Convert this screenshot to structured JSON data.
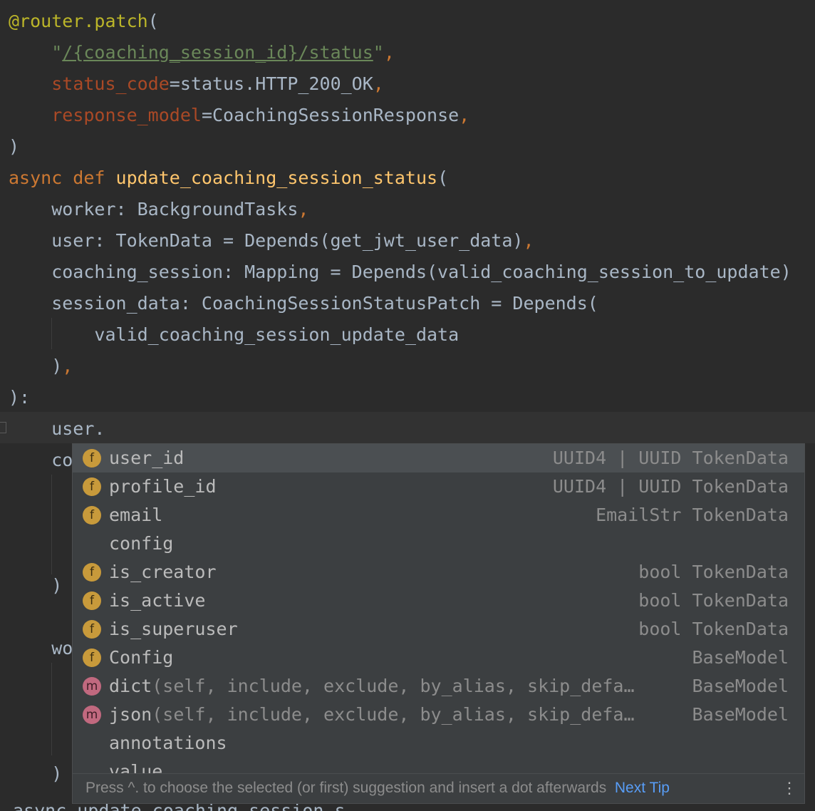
{
  "editor": {
    "lines": [
      [
        {
          "t": "@router.patch",
          "c": "deco"
        },
        {
          "t": "(",
          "c": "plain"
        }
      ],
      [
        {
          "t": "    ",
          "c": "plain"
        },
        {
          "t": "\"",
          "c": "str"
        },
        {
          "t": "/{coaching_session_id}/status",
          "c": "str-u"
        },
        {
          "t": "\"",
          "c": "str"
        },
        {
          "t": ",",
          "c": "kw"
        }
      ],
      [
        {
          "t": "    ",
          "c": "plain"
        },
        {
          "t": "status_code",
          "c": "param"
        },
        {
          "t": "=status.HTTP_200_OK",
          "c": "plain"
        },
        {
          "t": ",",
          "c": "kw"
        }
      ],
      [
        {
          "t": "    ",
          "c": "plain"
        },
        {
          "t": "response_model",
          "c": "param"
        },
        {
          "t": "=CoachingSessionResponse",
          "c": "plain"
        },
        {
          "t": ",",
          "c": "kw"
        }
      ],
      [
        {
          "t": ")",
          "c": "plain"
        }
      ],
      [
        {
          "t": "async def ",
          "c": "kw"
        },
        {
          "t": "update_coaching_session_status",
          "c": "fn"
        },
        {
          "t": "(",
          "c": "plain"
        }
      ],
      [
        {
          "t": "    worker: BackgroundTasks",
          "c": "plain"
        },
        {
          "t": ",",
          "c": "kw"
        }
      ],
      [
        {
          "t": "    user: TokenData = Depends(get_jwt_user_data)",
          "c": "plain"
        },
        {
          "t": ",",
          "c": "kw"
        }
      ],
      [
        {
          "t": "    coaching_session: Mapping = Depends(valid_coaching_session_to_update)",
          "c": "plain"
        }
      ],
      [
        {
          "t": "    session_data: CoachingSessionStatusPatch = Depends(",
          "c": "plain"
        }
      ],
      [
        {
          "t": "        valid_coaching_session_update_data",
          "c": "plain"
        }
      ],
      [
        {
          "t": "    )",
          "c": "plain"
        },
        {
          "t": ",",
          "c": "kw"
        }
      ],
      [
        {
          "t": "):",
          "c": "plain"
        }
      ],
      [
        {
          "t": "    user.",
          "c": "plain"
        }
      ],
      [
        {
          "t": "    co",
          "c": "plain"
        }
      ],
      [
        {
          "t": "",
          "c": "plain"
        }
      ],
      [
        {
          "t": "",
          "c": "plain"
        }
      ],
      [
        {
          "t": "",
          "c": "plain"
        }
      ],
      [
        {
          "t": "    )",
          "c": "plain"
        }
      ],
      [
        {
          "t": "",
          "c": "plain"
        }
      ],
      [
        {
          "t": "    wo",
          "c": "plain"
        }
      ],
      [
        {
          "t": "",
          "c": "plain"
        }
      ],
      [
        {
          "t": "",
          "c": "plain"
        }
      ],
      [
        {
          "t": "",
          "c": "plain"
        }
      ],
      [
        {
          "t": "    )",
          "c": "plain"
        }
      ]
    ],
    "bottom_partial": "async update_coaching_session_s"
  },
  "completion": {
    "items": [
      {
        "icon": "f",
        "icon_label": "f",
        "name": "user_id",
        "sig": "",
        "type": "UUID4 | UUID TokenData",
        "selected": true
      },
      {
        "icon": "f",
        "icon_label": "f",
        "name": "profile_id",
        "sig": "",
        "type": "UUID4 | UUID TokenData",
        "selected": false
      },
      {
        "icon": "f",
        "icon_label": "f",
        "name": "email",
        "sig": "",
        "type": "EmailStr TokenData",
        "selected": false
      },
      {
        "icon": "",
        "icon_label": "",
        "name": "config",
        "sig": "",
        "type": "",
        "selected": false
      },
      {
        "icon": "f",
        "icon_label": "f",
        "name": "is_creator",
        "sig": "",
        "type": "bool TokenData",
        "selected": false
      },
      {
        "icon": "f",
        "icon_label": "f",
        "name": "is_active",
        "sig": "",
        "type": "bool TokenData",
        "selected": false
      },
      {
        "icon": "f",
        "icon_label": "f",
        "name": "is_superuser",
        "sig": "",
        "type": "bool TokenData",
        "selected": false
      },
      {
        "icon": "f",
        "icon_label": "f",
        "name": "Config",
        "sig": "",
        "type": "BaseModel",
        "selected": false
      },
      {
        "icon": "m",
        "icon_label": "m",
        "name": "dict",
        "sig": "(self, include, exclude, by_alias, skip_defa…",
        "type": "BaseModel",
        "selected": false
      },
      {
        "icon": "m",
        "icon_label": "m",
        "name": "json",
        "sig": "(self, include, exclude, by_alias, skip_defa…",
        "type": "BaseModel",
        "selected": false
      },
      {
        "icon": "",
        "icon_label": "",
        "name": "annotations",
        "sig": "",
        "type": "",
        "selected": false
      },
      {
        "icon": "",
        "icon_label": "",
        "name": "value",
        "sig": "",
        "type": "",
        "selected": false
      }
    ],
    "footer": {
      "hint": "Press ^. to choose the selected (or first) suggestion and insert a dot afterwards",
      "tip_link": "Next Tip",
      "more": "⋮"
    }
  }
}
